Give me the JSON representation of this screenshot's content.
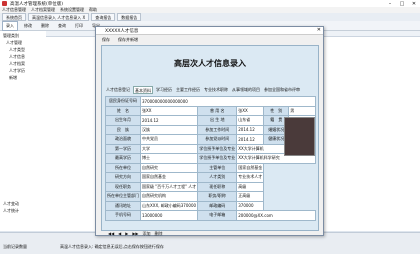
{
  "app": {
    "title": "高温人才管理系统(单位版)"
  },
  "menu": [
    "人才信息管理",
    "人才档案管理",
    "系统设置管理",
    "帮助"
  ],
  "tabs": [
    "系统首页",
    "高温信息录入 人才信息录入 X",
    "查询报告",
    "数据报告"
  ],
  "toolbar": [
    "录入",
    "修改",
    "删除",
    "查询",
    "打印",
    "导出"
  ],
  "left_tree": [
    "管理类别",
    "人才管理",
    "人才类型",
    "人才信息",
    "人才档案",
    "人才学历",
    "新增",
    "人才变动",
    "人才统计"
  ],
  "dialog": {
    "title": "XXXXX人才信息",
    "toolbar": [
      "保存",
      "保存并新增"
    ],
    "form_title": "高层次人才信息录入",
    "form_tabs": [
      "人才信息登记",
      "基本资料",
      "学习经历",
      "主要工作经历",
      "专业技术职称",
      "从事领域的项目",
      "参加全国和省市评审",
      "获奖",
      "主要业绩"
    ],
    "rows": [
      [
        {
          "l": "居民身份证号码"
        },
        {
          "v": "370000000000000000",
          "span": 7
        }
      ],
      [
        {
          "l": "姓　名"
        },
        {
          "v": "张XX"
        },
        {
          "l": "曾 用 名"
        },
        {
          "v": "张XX"
        },
        {
          "l": "性　别"
        },
        {
          "v": "男"
        }
      ],
      [
        {
          "l": "出生年月"
        },
        {
          "v": "2014.12"
        },
        {
          "l": "出 生 地"
        },
        {
          "v": "山东省"
        },
        {
          "l": "籍　贯"
        },
        {
          "v": "山东省"
        }
      ],
      [
        {
          "l": "民　族"
        },
        {
          "v": "汉族"
        },
        {
          "l": "参加工作时间"
        },
        {
          "v": "2014.12"
        },
        {
          "l": "婚姻状况"
        },
        {
          "v": "已婚"
        }
      ],
      [
        {
          "l": "政治面貌"
        },
        {
          "v": "中共党员"
        },
        {
          "l": "参加党派时间"
        },
        {
          "v": "2014.12"
        },
        {
          "l": "健康状况"
        },
        {
          "v": "良好"
        }
      ],
      [
        {
          "l": "第一学历"
        },
        {
          "v": "大学"
        },
        {
          "l": "学位授予单位及专业"
        },
        {
          "v": "XX大学计算机",
          "span": 3
        }
      ],
      [
        {
          "l": "最高学历"
        },
        {
          "v": "博士"
        },
        {
          "l": "学位授予单位及专业"
        },
        {
          "v": "XX大学计算机科学研究",
          "span": 3
        }
      ],
      [
        {
          "l": "所在单位"
        },
        {
          "v": "自然研究"
        },
        {
          "l": "主管单位"
        },
        {
          "v": "国家自然基金"
        }
      ],
      [
        {
          "l": "研究方向"
        },
        {
          "v": "国家自然基金"
        },
        {
          "l": "人才类别"
        },
        {
          "v": "专业技术人才"
        }
      ],
      [
        {
          "l": "现任职务"
        },
        {
          "v": "国家级 \"百千万人才工程\" 人才"
        },
        {
          "l": "现任职称"
        },
        {
          "v": "高级"
        }
      ],
      [
        {
          "l": "所在单位主管部门"
        },
        {
          "v": "自然研究机构"
        },
        {
          "l": "职务/职称"
        },
        {
          "v": "正高级"
        }
      ],
      [
        {
          "l": "通讯地址"
        },
        {
          "v": "山东XXX, 邮政小编码370000"
        },
        {
          "l": "邮政编码"
        },
        {
          "v": "370000"
        }
      ],
      [
        {
          "l": "手机号码"
        },
        {
          "v": "13000000"
        },
        {
          "l": "电子邮箱"
        },
        {
          "v": "200000@XX.com",
          "span": 3
        }
      ]
    ],
    "nav": [
      "◀◀",
      "◀",
      "▶",
      "▶▶",
      "添加",
      "删除"
    ]
  },
  "status": {
    "left": "当前记录数量",
    "msg": "高温人才信息录入: 确定信息无误后,点击保存按钮进行保存"
  }
}
